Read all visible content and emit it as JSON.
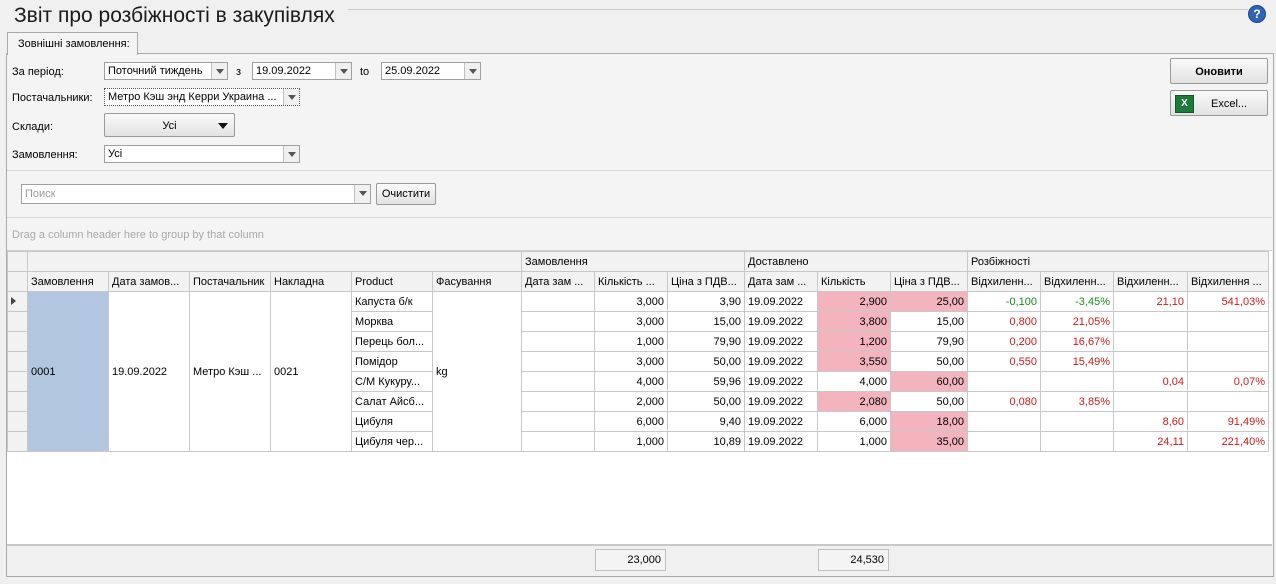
{
  "title": "Звіт про розбіжності в закупівлях",
  "tab_label": "Зовнішні замовлення:",
  "filters": {
    "period_label": "За період:",
    "period_value": "Поточний тиждень",
    "from_label": "з",
    "from_date": "19.09.2022",
    "to_label": "to",
    "to_date": "25.09.2022",
    "suppliers_label": "Постачальники:",
    "suppliers_value": "Метро Кэш энд Керри Украина ...",
    "warehouses_label": "Склади:",
    "warehouses_value": "Усі",
    "orders_label": "Замовлення:",
    "orders_value": "Усі"
  },
  "buttons": {
    "refresh": "Оновити",
    "excel": "Excel...",
    "clear": "Очистити"
  },
  "search": {
    "placeholder": "Поиск"
  },
  "group_hint": "Drag a column header here to group by that column",
  "group_headers": {
    "orders": "Замовлення",
    "delivered": "Доставлено",
    "differences": "Розбіжності"
  },
  "columns": [
    "Замовлення",
    "Дата замов...",
    "Постачальник",
    "Накладна",
    "Product",
    "Фасування",
    "Дата зам ...",
    "Кількість ...",
    "Ціна з ПДВ...",
    "Дата зам ...",
    "Кількість",
    "Ціна з ПДВ...",
    "Відхиленн...",
    "Відхиленн...",
    "Відхиленн...",
    "Відхилення ..."
  ],
  "merged": {
    "order": "0001",
    "date": "19.09.2022",
    "supplier": "Метро Кэш ...",
    "invoice": "0021",
    "packing": "kg"
  },
  "rows": [
    {
      "product": "Капуста б/к",
      "order_date": "",
      "qty": "3,000",
      "price": "3,90",
      "del_date": "19.09.2022",
      "del_qty": "2,900",
      "del_price": "25,00",
      "d1": "-0,100",
      "d2": "-3,45%",
      "d3": "21,10",
      "d4": "541,03%"
    },
    {
      "product": "Морква",
      "order_date": "",
      "qty": "3,000",
      "price": "15,00",
      "del_date": "19.09.2022",
      "del_qty": "3,800",
      "del_price": "15,00",
      "d1": "0,800",
      "d2": "21,05%",
      "d3": "",
      "d4": ""
    },
    {
      "product": "Перець бол...",
      "order_date": "",
      "qty": "1,000",
      "price": "79,90",
      "del_date": "19.09.2022",
      "del_qty": "1,200",
      "del_price": "79,90",
      "d1": "0,200",
      "d2": "16,67%",
      "d3": "",
      "d4": ""
    },
    {
      "product": "Помідор",
      "order_date": "",
      "qty": "3,000",
      "price": "50,00",
      "del_date": "19.09.2022",
      "del_qty": "3,550",
      "del_price": "50,00",
      "d1": "0,550",
      "d2": "15,49%",
      "d3": "",
      "d4": ""
    },
    {
      "product": "С/М Кукуру...",
      "order_date": "",
      "qty": "4,000",
      "price": "59,96",
      "del_date": "19.09.2022",
      "del_qty": "4,000",
      "del_price": "60,00",
      "d1": "",
      "d2": "",
      "d3": "0,04",
      "d4": "0,07%"
    },
    {
      "product": "Салат Айсб...",
      "order_date": "",
      "qty": "2,000",
      "price": "50,00",
      "del_date": "19.09.2022",
      "del_qty": "2,080",
      "del_price": "50,00",
      "d1": "0,080",
      "d2": "3,85%",
      "d3": "",
      "d4": ""
    },
    {
      "product": "Цибуля",
      "order_date": "",
      "qty": "6,000",
      "price": "9,40",
      "del_date": "19.09.2022",
      "del_qty": "6,000",
      "del_price": "18,00",
      "d1": "",
      "d2": "",
      "d3": "8,60",
      "d4": "91,49%"
    },
    {
      "product": "Цибуля чер...",
      "order_date": "",
      "qty": "1,000",
      "price": "10,89",
      "del_date": "19.09.2022",
      "del_qty": "1,000",
      "del_price": "35,00",
      "d1": "",
      "d2": "",
      "d3": "24,11",
      "d4": "221,40%"
    }
  ],
  "totals": {
    "ordered_qty": "23,000",
    "delivered_qty": "24,530"
  },
  "colors": {
    "highlight_pink": "#f3b4be",
    "selected_blue": "#b3c6e0",
    "positive_red": "#d11a1a",
    "negative_green": "#1a8c1a"
  }
}
